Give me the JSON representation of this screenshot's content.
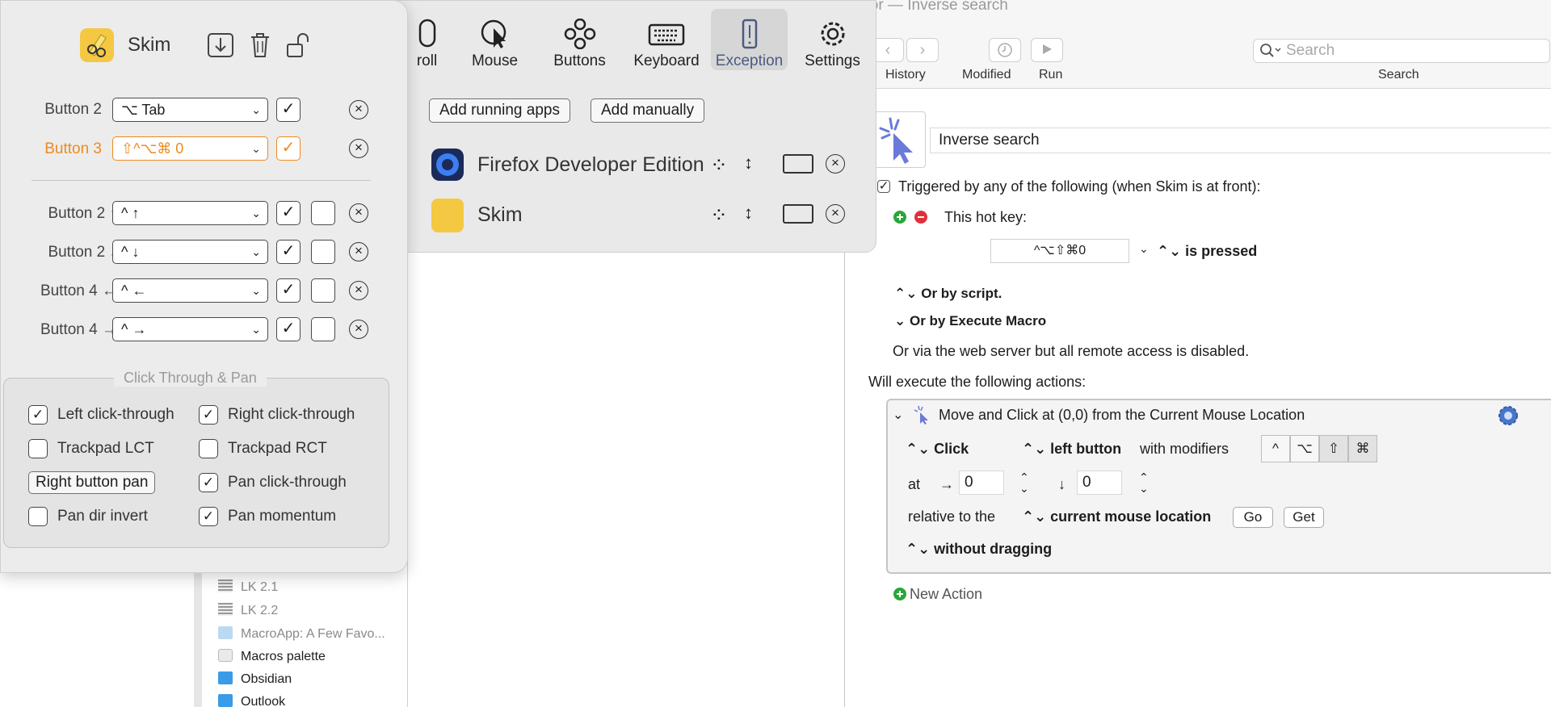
{
  "editor": {
    "window_title": "Macro Editor — Inverse search",
    "toolbar": {
      "history": "History",
      "modified": "Modified",
      "run": "Run",
      "search_placeholder": "Search",
      "search_label": "Search"
    },
    "macro_name": "Inverse search",
    "trigger_text": "Triggered by any of the following (when Skim is at front):",
    "hotkey_label": "This hot key:",
    "hotkey_value": "^⌥⇧⌘0",
    "hotkey_state": "is pressed",
    "or_script": "Or by script.",
    "or_execute": "Or by Execute Macro",
    "web_server": "Or via the web server but all remote access is disabled.",
    "will_execute": "Will execute the following actions:",
    "action": {
      "title": "Move and Click at (0,0) from the Current Mouse Location",
      "click": "Click",
      "button": "left button",
      "with_modifiers": "with modifiers",
      "modifiers": [
        "^",
        "⌥",
        "⇧",
        "⌘"
      ],
      "at": "at",
      "x": "0",
      "y": "0",
      "relative_to": "relative to the",
      "relative_value": "current mouse location",
      "go": "Go",
      "get": "Get",
      "dragging": "without dragging"
    },
    "new_action": "New Action"
  },
  "macro_list": [
    "LK 2.1",
    "LK 2.2",
    "MacroApp: A Few Favo...",
    "Macros palette",
    "Obsidian",
    "Outlook"
  ],
  "btt": {
    "tabs": [
      "roll",
      "Mouse",
      "Buttons",
      "Keyboard",
      "Exception",
      "Settings"
    ],
    "add_running": "Add running apps",
    "add_manually": "Add manually",
    "apps": [
      "Firefox Developer Edition",
      "Skim"
    ]
  },
  "skim": {
    "app_name": "Skim",
    "rows_top": [
      {
        "label": "Button 2",
        "value": "⌥ Tab",
        "checked": true
      },
      {
        "label": "Button 3",
        "value": "⇧^⌥⌘ 0",
        "checked": true
      }
    ],
    "rows_bottom": [
      {
        "label": "Button 2 ↑",
        "value": "^ ↑"
      },
      {
        "label": "Button 2 ↓",
        "value": "^ ↓"
      },
      {
        "label": "Button 4 ←",
        "value": "^ ←"
      },
      {
        "label": "Button 4 →",
        "value": "^ →"
      }
    ],
    "group_title": "Click Through & Pan",
    "options": {
      "left_click": "Left click-through",
      "right_click": "Right click-through",
      "trackpad_lct": "Trackpad LCT",
      "trackpad_rct": "Trackpad RCT",
      "right_pan": "Right button pan",
      "pan_click": "Pan click-through",
      "pan_dir": "Pan dir invert",
      "pan_momentum": "Pan momentum"
    }
  }
}
